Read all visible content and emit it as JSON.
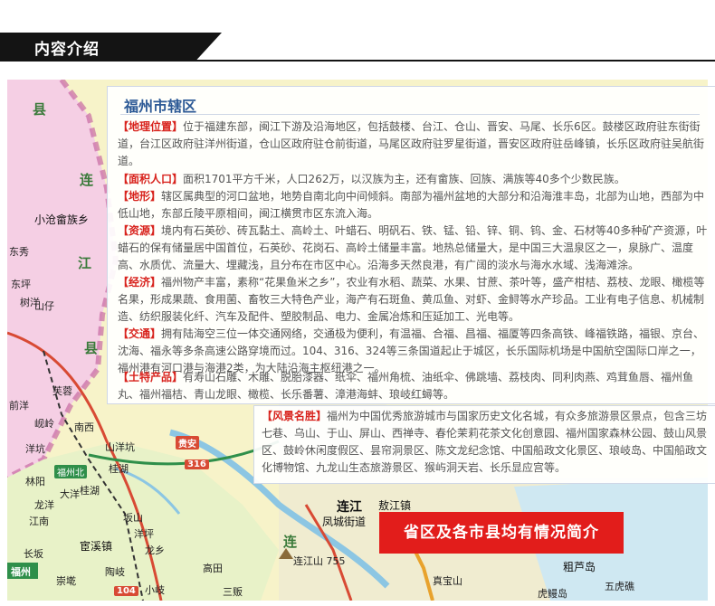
{
  "header": {
    "section_title": "内容介绍"
  },
  "panel": {
    "title": "福州市辖区",
    "sections": [
      {
        "tag": "【地理位置】",
        "text": "位于福建东部，闽江下游及沿海地区，包括鼓楼、台江、仓山、晋安、马尾、长乐6区。鼓楼区政府驻东街街道，台江区政府驻洋州街道，仓山区政府驻仓前街道，马尾区政府驻罗星街道，晋安区政府驻岳峰镇，长乐区政府驻吴航街道。"
      },
      {
        "tag": "【面积人口】",
        "text": "面积1701平方千米，人口262万，以汉族为主，还有畲族、回族、满族等40多个少数民族。"
      },
      {
        "tag": "【地形】",
        "text": "辖区属典型的河口盆地，地势自南北向中间倾斜。南部为福州盆地的大部分和沿海淮丰岛，北部为山地，西部为中低山地，东部丘陵平原相间，闽江横贯市区东流入海。"
      },
      {
        "tag": "【资源】",
        "text": "境内有石英砂、砖瓦黏土、高岭土、叶蜡石、明矾石、铁、锰、铅、锌、铜、钨、金、石材等40多种矿产资源，叶蜡石的保有储量居中国首位，石英砂、花岗石、高岭土储量丰富。地热总储量大，是中国三大温泉区之一，泉脉广、温度高、水质优、流量大、埋藏浅，且分布在市区中心。沿海多天然良港，有广阔的淡水与海水水域、浅海滩涂。"
      },
      {
        "tag": "【经济】",
        "text": "福州物产丰富，素称“花果鱼米之乡”，农业有水稻、蔬菜、水果、甘蔗、茶叶等，盛产柑桔、荔枝、龙眼、橄榄等名果，形成果蔬、食用菌、畜牧三大特色产业，海产有石斑鱼、黄瓜鱼、对虾、金鲟等水产珍品。工业有电子信息、机械制造、纺织服装化纤、汽车及配件、塑胶制品、电力、金属冶炼和压延加工、光电等。"
      },
      {
        "tag": "【交通】",
        "text": "拥有陆海空三位一体交通网络，交通极为便利，有温福、合福、昌福、福厦等四条高铁、峰福铁路，福银、京台、沈海、福永等多条高速公路穿境而过。104、316、324等三条国道起止于城区，长乐国际机场是中国航空国际口岸之一，福州港有河口港与海港2类，为大陆沿海主枢纽港之一。"
      },
      {
        "tag": "【土特产品】",
        "text": "有寿山石雕、木雕、脱胎漆器、纸伞、福州角梳、油纸伞、佛跳墙、荔枝肉、同利肉燕、鸡茸鱼唇、福州鱼丸、福州福桔、青山龙眼、橄榄、长乐番薯、漳港海蚌、琅岐红蟳等。"
      }
    ]
  },
  "panel2": {
    "tag": "【风景名胜】",
    "text": "福州为中国优秀旅游城市与国家历史文化名城，有众多旅游景区景点，包含三坊七巷、乌山、于山、屏山、西禅寺、春伦茉莉花茶文化创意园、福州国家森林公园、鼓山风景区、鼓岭休闲度假区、昙帘洞景区、陈文龙纪念馆、中国船政文化景区、琅岐岛、中国船政文化博物馆、九龙山生态旅游景区、猴屿洞天岩、长乐显应宫等。"
  },
  "banner": {
    "text": "省区及各市县均有情况简介"
  },
  "map_labels": {
    "xian_top": "县",
    "lian": "连",
    "jiang": "江",
    "xian": "县",
    "lian2": "连",
    "xiaocang": "小沧畲族乡",
    "dongxiu": "东秀",
    "dongping": "东坪",
    "shuyang": "树洋",
    "shangu": "山仔",
    "furong": "芙蓉",
    "qianyang": "前洋",
    "eling": "岘岭",
    "nandian": "南西",
    "yangkang": "洋坑",
    "shanyang": "山洋坑",
    "linyuan": "林阳",
    "guian": "贵安",
    "fuzhoubei": "福州北",
    "guihu": "桂湖",
    "guizhou": "桂湖",
    "dayang": "大洋",
    "longyang": "龙洋",
    "jiangnan": "江南",
    "banshan": "坂山",
    "gongxiang": "宦溪镇",
    "longxiang": "龙乡",
    "chongqian": "崇墘",
    "changbai": "长坂",
    "yangqian": "洋坪",
    "gaotian": "高田",
    "sanfan": "三贩",
    "xiaoqi": "小岐",
    "taoqian": "陶岐",
    "lianjiang": "连江",
    "aojiang": "敖江镇",
    "fengcheng": "凤城街道",
    "lianjiang_peak": "连江山 755",
    "zhenbao": "真宝山",
    "cuqian": "粗芦岛",
    "wuhu": "五虎礁",
    "hulan": "虎鳗岛",
    "fuzhou_badge": "福州",
    "g316": "316",
    "g104": "104"
  }
}
